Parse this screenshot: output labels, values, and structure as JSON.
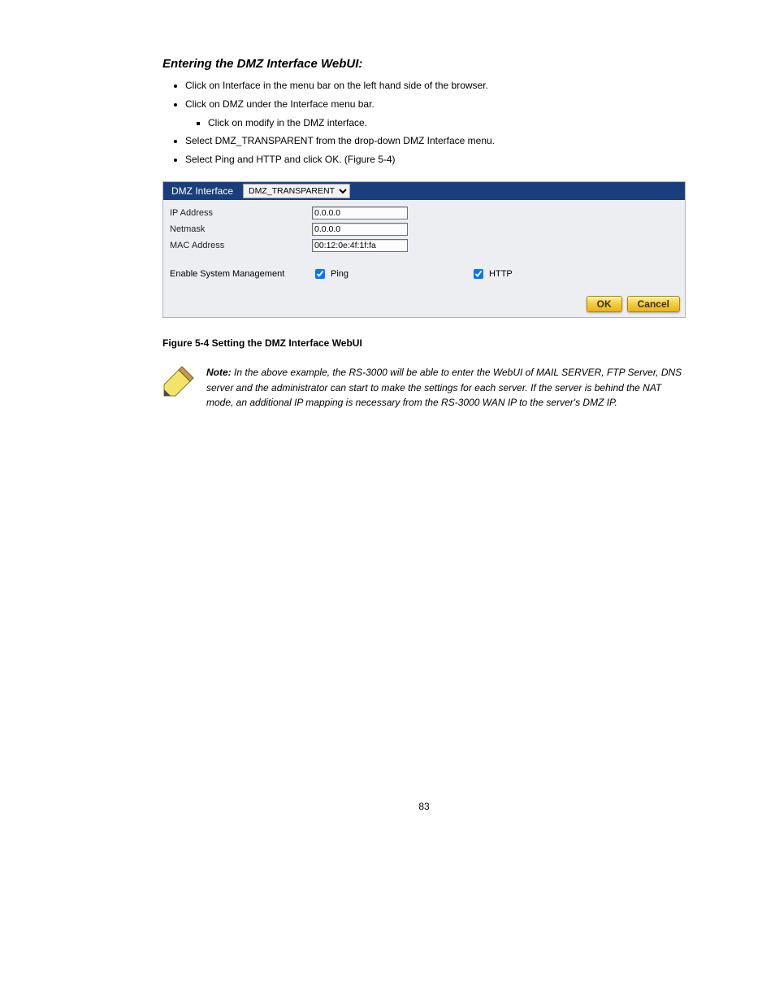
{
  "title": "Entering the DMZ Interface WebUI:",
  "list": [
    "Click on Interface in the menu bar on the left hand side of the browser.",
    "Click on DMZ under the Interface menu bar.",
    "Select DMZ_TRANSPARENT from the drop-down DMZ Interface menu.",
    "Select Ping and HTTP and click OK. (Figure 5-4)"
  ],
  "sublist": [
    "Click on modify in the DMZ interface."
  ],
  "panel": {
    "header_label": "DMZ Interface",
    "select_value": "DMZ_TRANSPARENT",
    "rows": {
      "ip_label": "IP Address",
      "ip_value": "0.0.0.0",
      "netmask_label": "Netmask",
      "netmask_value": "0.0.0.0",
      "mac_label": "MAC Address",
      "mac_value": "00:12:0e:4f:1f:fa"
    },
    "mgmt": {
      "label": "Enable System Management",
      "ping": "Ping",
      "http": "HTTP"
    },
    "buttons": {
      "ok": "OK",
      "cancel": "Cancel"
    }
  },
  "figure_caption": "Figure 5-4 Setting the DMZ Interface WebUI",
  "note_text": "In the above example, the RS-3000 will be able to enter the WebUI of MAIL SERVER, FTP Server, DNS server and the administrator can start to make the settings for each server. If the server is behind the NAT mode, an additional IP mapping is necessary from the RS-3000 WAN IP to the server's DMZ IP.",
  "note_label": "Note:",
  "page_number": "83"
}
